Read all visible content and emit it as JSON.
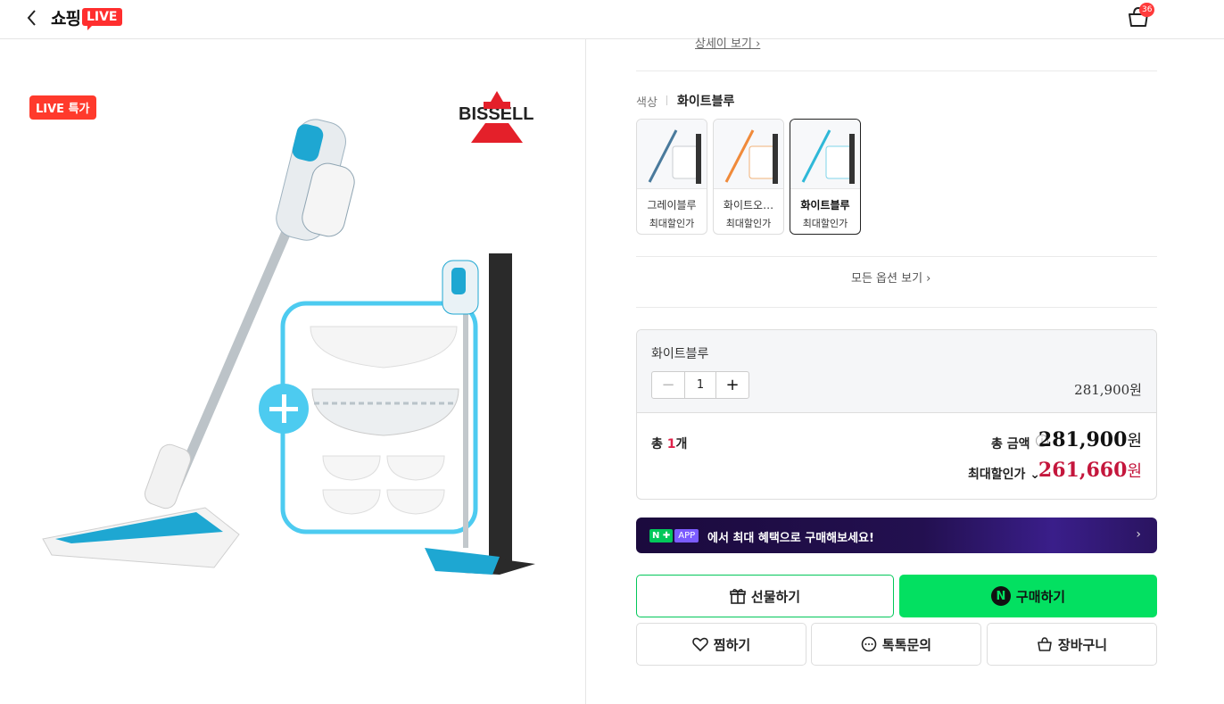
{
  "header": {
    "logo_text": "쇼핑",
    "logo_badge": "LIVE",
    "cart_count": "36"
  },
  "product": {
    "live_badge": "LIVE 특가",
    "brand": "BISSELL"
  },
  "detail_link": "상세이 보기",
  "color": {
    "label": "색상",
    "selected": "화이트블루"
  },
  "options": [
    {
      "name": "그레이블루",
      "sub": "최대할인가",
      "accent": "#4a7a9c"
    },
    {
      "name": "화이트오…",
      "sub": "최대할인가",
      "accent": "#f08a3a"
    },
    {
      "name": "화이트블루",
      "sub": "최대할인가",
      "accent": "#2fb8d8"
    }
  ],
  "all_options": "모든 옵션 보기",
  "selection": {
    "name": "화이트블루",
    "qty": "1",
    "price": "281,900원"
  },
  "totals": {
    "total_prefix": "총 ",
    "total_count": "1",
    "total_suffix": "개",
    "total_amount_label": "총 금액",
    "total_amount": "281,900",
    "won": "원",
    "max_label": "최대할인가",
    "max_amount": "261,660"
  },
  "banner": {
    "n_plus": "N ✚",
    "app": "APP",
    "text": "에서 최대 혜택으로 구매해보세요!"
  },
  "buttons": {
    "gift": "선물하기",
    "buy": "구매하기",
    "wish": "찜하기",
    "talk": "톡톡문의",
    "cart": "장바구니"
  },
  "colors": {
    "naver_green": "#03c75a",
    "discount_red": "#c4163c",
    "live_red": "#ff3a2c"
  }
}
